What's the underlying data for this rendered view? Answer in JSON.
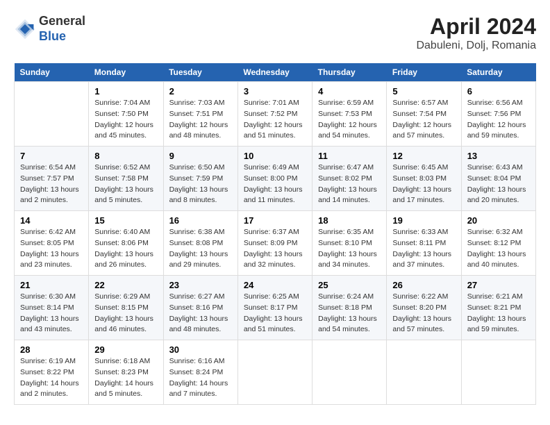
{
  "header": {
    "logo_line1": "General",
    "logo_line2": "Blue",
    "title": "April 2024",
    "subtitle": "Dabuleni, Dolj, Romania"
  },
  "weekdays": [
    "Sunday",
    "Monday",
    "Tuesday",
    "Wednesday",
    "Thursday",
    "Friday",
    "Saturday"
  ],
  "weeks": [
    [
      {
        "day": "",
        "sunrise": "",
        "sunset": "",
        "daylight": ""
      },
      {
        "day": "1",
        "sunrise": "Sunrise: 7:04 AM",
        "sunset": "Sunset: 7:50 PM",
        "daylight": "Daylight: 12 hours and 45 minutes."
      },
      {
        "day": "2",
        "sunrise": "Sunrise: 7:03 AM",
        "sunset": "Sunset: 7:51 PM",
        "daylight": "Daylight: 12 hours and 48 minutes."
      },
      {
        "day": "3",
        "sunrise": "Sunrise: 7:01 AM",
        "sunset": "Sunset: 7:52 PM",
        "daylight": "Daylight: 12 hours and 51 minutes."
      },
      {
        "day": "4",
        "sunrise": "Sunrise: 6:59 AM",
        "sunset": "Sunset: 7:53 PM",
        "daylight": "Daylight: 12 hours and 54 minutes."
      },
      {
        "day": "5",
        "sunrise": "Sunrise: 6:57 AM",
        "sunset": "Sunset: 7:54 PM",
        "daylight": "Daylight: 12 hours and 57 minutes."
      },
      {
        "day": "6",
        "sunrise": "Sunrise: 6:56 AM",
        "sunset": "Sunset: 7:56 PM",
        "daylight": "Daylight: 12 hours and 59 minutes."
      }
    ],
    [
      {
        "day": "7",
        "sunrise": "Sunrise: 6:54 AM",
        "sunset": "Sunset: 7:57 PM",
        "daylight": "Daylight: 13 hours and 2 minutes."
      },
      {
        "day": "8",
        "sunrise": "Sunrise: 6:52 AM",
        "sunset": "Sunset: 7:58 PM",
        "daylight": "Daylight: 13 hours and 5 minutes."
      },
      {
        "day": "9",
        "sunrise": "Sunrise: 6:50 AM",
        "sunset": "Sunset: 7:59 PM",
        "daylight": "Daylight: 13 hours and 8 minutes."
      },
      {
        "day": "10",
        "sunrise": "Sunrise: 6:49 AM",
        "sunset": "Sunset: 8:00 PM",
        "daylight": "Daylight: 13 hours and 11 minutes."
      },
      {
        "day": "11",
        "sunrise": "Sunrise: 6:47 AM",
        "sunset": "Sunset: 8:02 PM",
        "daylight": "Daylight: 13 hours and 14 minutes."
      },
      {
        "day": "12",
        "sunrise": "Sunrise: 6:45 AM",
        "sunset": "Sunset: 8:03 PM",
        "daylight": "Daylight: 13 hours and 17 minutes."
      },
      {
        "day": "13",
        "sunrise": "Sunrise: 6:43 AM",
        "sunset": "Sunset: 8:04 PM",
        "daylight": "Daylight: 13 hours and 20 minutes."
      }
    ],
    [
      {
        "day": "14",
        "sunrise": "Sunrise: 6:42 AM",
        "sunset": "Sunset: 8:05 PM",
        "daylight": "Daylight: 13 hours and 23 minutes."
      },
      {
        "day": "15",
        "sunrise": "Sunrise: 6:40 AM",
        "sunset": "Sunset: 8:06 PM",
        "daylight": "Daylight: 13 hours and 26 minutes."
      },
      {
        "day": "16",
        "sunrise": "Sunrise: 6:38 AM",
        "sunset": "Sunset: 8:08 PM",
        "daylight": "Daylight: 13 hours and 29 minutes."
      },
      {
        "day": "17",
        "sunrise": "Sunrise: 6:37 AM",
        "sunset": "Sunset: 8:09 PM",
        "daylight": "Daylight: 13 hours and 32 minutes."
      },
      {
        "day": "18",
        "sunrise": "Sunrise: 6:35 AM",
        "sunset": "Sunset: 8:10 PM",
        "daylight": "Daylight: 13 hours and 34 minutes."
      },
      {
        "day": "19",
        "sunrise": "Sunrise: 6:33 AM",
        "sunset": "Sunset: 8:11 PM",
        "daylight": "Daylight: 13 hours and 37 minutes."
      },
      {
        "day": "20",
        "sunrise": "Sunrise: 6:32 AM",
        "sunset": "Sunset: 8:12 PM",
        "daylight": "Daylight: 13 hours and 40 minutes."
      }
    ],
    [
      {
        "day": "21",
        "sunrise": "Sunrise: 6:30 AM",
        "sunset": "Sunset: 8:14 PM",
        "daylight": "Daylight: 13 hours and 43 minutes."
      },
      {
        "day": "22",
        "sunrise": "Sunrise: 6:29 AM",
        "sunset": "Sunset: 8:15 PM",
        "daylight": "Daylight: 13 hours and 46 minutes."
      },
      {
        "day": "23",
        "sunrise": "Sunrise: 6:27 AM",
        "sunset": "Sunset: 8:16 PM",
        "daylight": "Daylight: 13 hours and 48 minutes."
      },
      {
        "day": "24",
        "sunrise": "Sunrise: 6:25 AM",
        "sunset": "Sunset: 8:17 PM",
        "daylight": "Daylight: 13 hours and 51 minutes."
      },
      {
        "day": "25",
        "sunrise": "Sunrise: 6:24 AM",
        "sunset": "Sunset: 8:18 PM",
        "daylight": "Daylight: 13 hours and 54 minutes."
      },
      {
        "day": "26",
        "sunrise": "Sunrise: 6:22 AM",
        "sunset": "Sunset: 8:20 PM",
        "daylight": "Daylight: 13 hours and 57 minutes."
      },
      {
        "day": "27",
        "sunrise": "Sunrise: 6:21 AM",
        "sunset": "Sunset: 8:21 PM",
        "daylight": "Daylight: 13 hours and 59 minutes."
      }
    ],
    [
      {
        "day": "28",
        "sunrise": "Sunrise: 6:19 AM",
        "sunset": "Sunset: 8:22 PM",
        "daylight": "Daylight: 14 hours and 2 minutes."
      },
      {
        "day": "29",
        "sunrise": "Sunrise: 6:18 AM",
        "sunset": "Sunset: 8:23 PM",
        "daylight": "Daylight: 14 hours and 5 minutes."
      },
      {
        "day": "30",
        "sunrise": "Sunrise: 6:16 AM",
        "sunset": "Sunset: 8:24 PM",
        "daylight": "Daylight: 14 hours and 7 minutes."
      },
      {
        "day": "",
        "sunrise": "",
        "sunset": "",
        "daylight": ""
      },
      {
        "day": "",
        "sunrise": "",
        "sunset": "",
        "daylight": ""
      },
      {
        "day": "",
        "sunrise": "",
        "sunset": "",
        "daylight": ""
      },
      {
        "day": "",
        "sunrise": "",
        "sunset": "",
        "daylight": ""
      }
    ]
  ]
}
